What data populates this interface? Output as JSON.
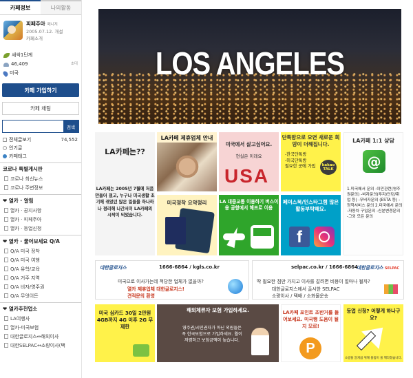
{
  "sidebar": {
    "tabs": [
      "카페정보",
      "나의활동"
    ],
    "profile": {
      "name": "피페주아",
      "role": "매니저",
      "date": "2005.07.12. 개설",
      "intro": "카페소개"
    },
    "stats": {
      "level": "새싹1단계",
      "members": "46,409",
      "invite": "초대",
      "location": "미국"
    },
    "join_label": "카페 가입하기",
    "chat_label": "카페 채팅",
    "search": {
      "placeholder": "",
      "button": "검색"
    },
    "menu": [
      {
        "label": "전체글보기",
        "count": "74,552"
      },
      {
        "label": "인기글",
        "count": ""
      },
      {
        "label": "카페태그",
        "count": ""
      }
    ],
    "sections": [
      {
        "title": "코로나 특별게시판",
        "items": [
          "코로나 최신뉴스",
          "코로나 주변정보"
        ]
      },
      {
        "title": "❤ 열카 · 알림",
        "items": [
          "열카 · 공지사항",
          "열카 · 피페주아",
          "열카 · 등업신청"
        ]
      },
      {
        "title": "❤ 열카 · 물어보세요 Q/A",
        "items": [
          "Q/A 미국 정착",
          "Q/A 미국 여행",
          "Q/A 유학/교육",
          "Q/A 거주 지역",
          "Q/A 비자/영주권",
          "Q/A 무엇이든"
        ]
      },
      {
        "title": "❤ 열카추천업소",
        "items": [
          "LA여행사",
          "열카-미국보험",
          "대한글로지스↔해외이사",
          "대한SELPAC↔소량이사(택"
        ]
      }
    ]
  },
  "banner": {
    "title": "LOS ANGELES"
  },
  "tiles": {
    "about": {
      "title": "LA카페는??",
      "body": "LA카페는 2005년 7월에 처음 만들어 졌고, 누구나 미국생활 초기에 겪었던 많은 일들을 하나하나 정리해 나간서이 LA카페의 시작이 되었습니다."
    },
    "partner": {
      "title": "LA카페 제휴업체 안내"
    },
    "live": {
      "title": "미국에서 살고싶어요.",
      "sub": "현실은 이래요",
      "usa": "USA"
    },
    "kakao": {
      "title": "단톡방으로 오면 새로운 희망이 더해집니다.",
      "lines": [
        "-한국단톡방",
        "-미국단톡방",
        "필요한 곳에 가입"
      ],
      "talk": "kakao TALK"
    },
    "consult": {
      "title": "LA카페 1:1 상담",
      "body": "1.미국에서 문의 -이민관련(영주권문의) -비자문의(투자/인턴/취업 등) -무비자문의 (ESTA 등) -정착서비스 문의  2.미국에서 문의 -자동차 구입문의 -신분변경문의 -그외 모든 문의"
    },
    "settle": {
      "title": "미국정착 요약정리"
    },
    "transport": {
      "title": "LA 대중교통 이용하기 버스이용 공항에서 해프로 이용"
    },
    "sns": {
      "title": "페이스북/인스타그램 많은 활동부탁해요.",
      "fb": "f"
    }
  },
  "ads": [
    {
      "logo": "대한글로지스",
      "logo_sub": "",
      "phone": "1666-6864 / kgls.co.kr",
      "line1": "미국으로 이사가는데 적당한 업체가 없을까?",
      "line2": "열카 제휴업체 대한글로지스!",
      "line3": "견적문의 환영"
    },
    {
      "logo": "대한글로지스",
      "logo_sub": "SELPAC",
      "phone": "selpac.co.kr / 1666-6864",
      "line1": "딱 필요한 짐만 가지고 이사를 갈려면 비용이 얼마나 될까?",
      "line2": "대한글로지스에서 출시한 SELPAC",
      "line3": "소량이사 / 택배 / 소화물운송"
    }
  ],
  "bottom": {
    "sim": {
      "text": "미국 심카드 30일 2만원 4GB까지 4G 이후 2G 무제한"
    },
    "insurance": {
      "title": "해외체류자 보험 가입하세요.",
      "text": "영주권/시민권자가 아닌 외원들은 꼭 한국보험으로 가입하세요. 월이 저렴하고 보험금액이 높습니다."
    },
    "point": {
      "text": "LA카페 포인트 초반거를 들어보세요. 미국행 도움이 될지 모르!",
      "coin": "P"
    },
    "upgrade": {
      "text": "등업 신청? 어떻게 하나구요?",
      "sub": "소량을 알게끔 위해 올림이 올 께다졌습니다."
    }
  }
}
